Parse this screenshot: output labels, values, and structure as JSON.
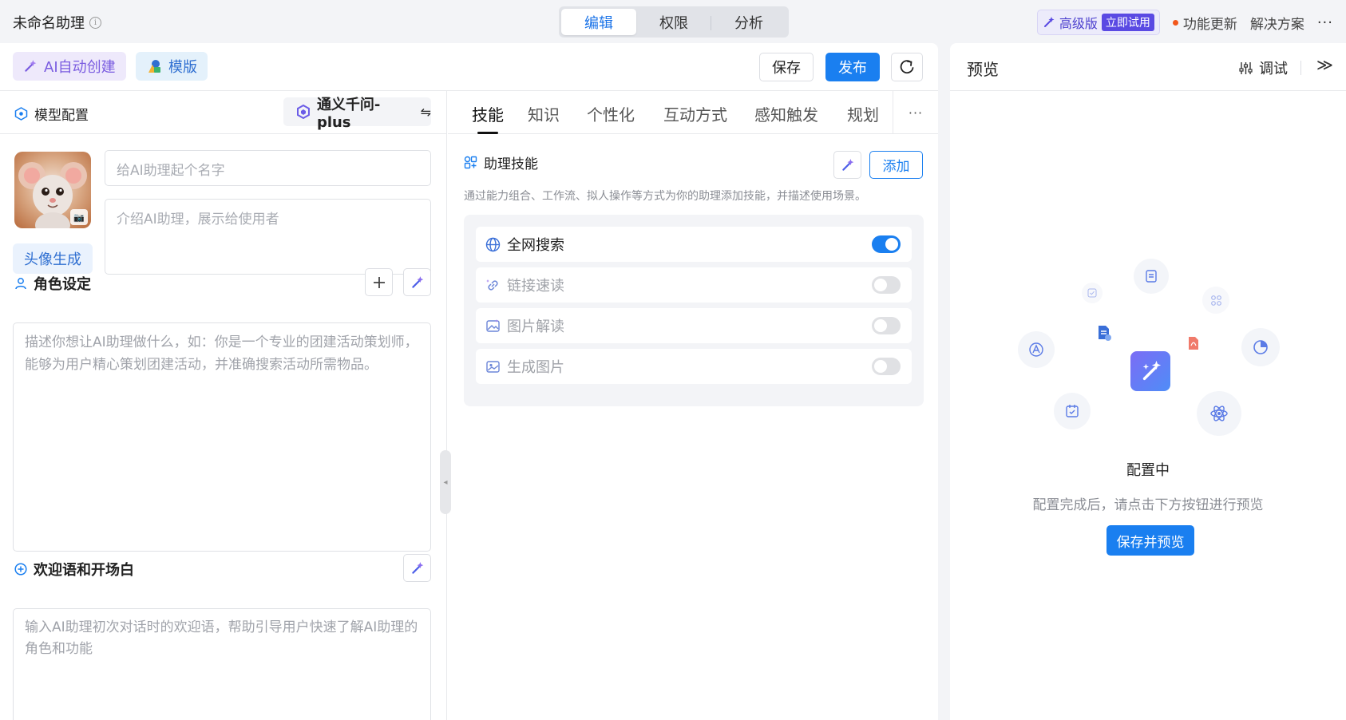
{
  "header": {
    "title": "未命名助理",
    "segments": [
      "编辑",
      "权限",
      "分析"
    ],
    "active_segment": "编辑",
    "pro_label": "高级版",
    "trial_label": "立即试用",
    "update_label": "功能更新",
    "solutions_label": "解决方案"
  },
  "toolbar": {
    "ai_create_label": "AI自动创建",
    "template_label": "模版",
    "save_label": "保存",
    "publish_label": "发布"
  },
  "config": {
    "model_label": "模型配置",
    "model_name": "通义千问-plus",
    "name_placeholder": "给AI助理起个名字",
    "intro_placeholder": "介绍AI助理，展示给使用者",
    "avatar_button": "头像生成",
    "role_title": "角色设定",
    "role_placeholder": "描述你想让AI助理做什么，如：你是一个专业的团建活动策划师，能够为用户精心策划团建活动，并准确搜索活动所需物品。",
    "welcome_title": "欢迎语和开场白",
    "welcome_placeholder": "输入AI助理初次对话时的欢迎语，帮助引导用户快速了解AI助理的角色和功能"
  },
  "tabs": {
    "items": [
      "技能",
      "知识",
      "个性化",
      "互动方式",
      "感知触发",
      "规划"
    ],
    "active": "技能"
  },
  "skills": {
    "title": "助理技能",
    "add_label": "添加",
    "description": "通过能力组合、工作流、拟人操作等方式为你的助理添加技能，并描述使用场景。",
    "items": [
      {
        "label": "全网搜索",
        "enabled": true,
        "icon": "globe-icon"
      },
      {
        "label": "链接速读",
        "enabled": false,
        "icon": "link-icon"
      },
      {
        "label": "图片解读",
        "enabled": false,
        "icon": "image-sparkle-icon"
      },
      {
        "label": "生成图片",
        "enabled": false,
        "icon": "image-icon"
      }
    ]
  },
  "preview": {
    "title": "预览",
    "debug_label": "调试",
    "status_title": "配置中",
    "status_desc": "配置完成后，请点击下方按钮进行预览",
    "save_preview_label": "保存并预览"
  },
  "colors": {
    "primary": "#1a7ff0",
    "purple_accent": "#7a5ce0",
    "update_dot": "#f2571b"
  }
}
